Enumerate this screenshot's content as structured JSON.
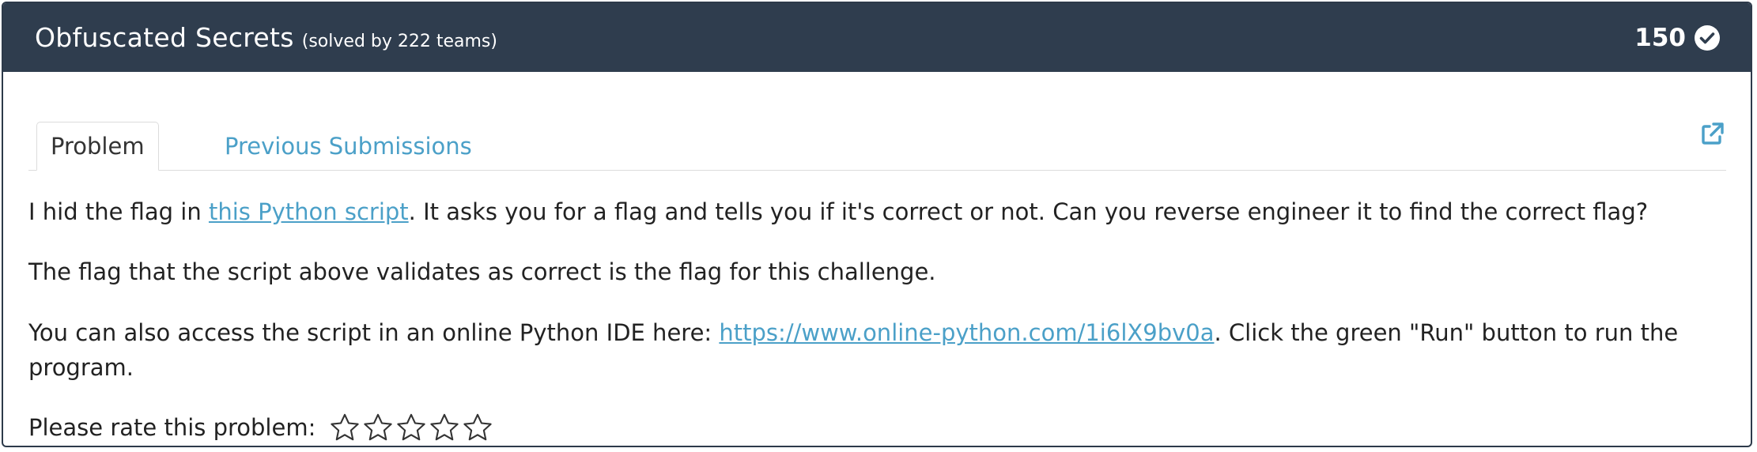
{
  "header": {
    "title": "Obfuscated Secrets",
    "solved": "(solved by 222 teams)",
    "points": "150",
    "check_icon": "check-circle-icon",
    "bg_color": "#2f3d4e"
  },
  "tabs": [
    {
      "label": "Problem",
      "active": true
    },
    {
      "label": "Previous Submissions",
      "active": false
    }
  ],
  "external_icon": "external-link-icon",
  "accent_color": "#4ba0c8",
  "problem": {
    "p1_before": "I hid the flag in ",
    "p1_link": "this Python script",
    "p1_after": ". It asks you for a flag and tells you if it's correct or not. Can you reverse engineer it to find the correct flag?",
    "p2": "The flag that the script above validates as correct is the flag for this challenge.",
    "p3_before": "You can also access the script in an online Python IDE here: ",
    "p3_link": "https://www.online-python.com/1i6lX9bv0a",
    "p3_after_line1": ". Click the green \"Run\" button to run the",
    "p3_line2": "program.",
    "rate_label": "Please rate this problem:"
  },
  "rating": {
    "max_stars": 5,
    "selected": 0,
    "icon": "star-outline-icon"
  }
}
